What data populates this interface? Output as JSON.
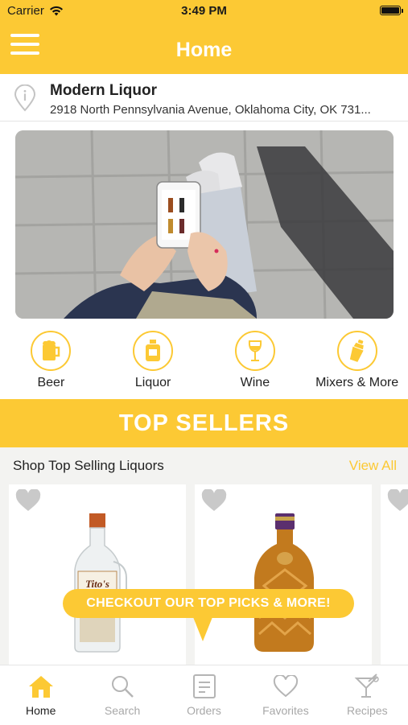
{
  "status_bar": {
    "carrier": "Carrier",
    "time": "3:49 PM"
  },
  "nav": {
    "title": "Home"
  },
  "store": {
    "name": "Modern Liquor",
    "address": "2918 North Pennsylvania Avenue, Oklahoma City, OK 731..."
  },
  "categories": [
    {
      "label": "Beer",
      "icon": "beer-mug-icon"
    },
    {
      "label": "Liquor",
      "icon": "liquor-bottle-icon"
    },
    {
      "label": "Wine",
      "icon": "wine-glass-icon"
    },
    {
      "label": "Mixers & More",
      "icon": "cocktail-shaker-icon"
    }
  ],
  "top_sellers": {
    "banner": "TOP SELLERS",
    "section_title": "Shop Top Selling Liquors",
    "view_all": "View All",
    "promo": "CHECKOUT OUR TOP PICKS & MORE!",
    "products": [
      {
        "image": "titos-vodka-bottle",
        "label_text": "Tito's"
      },
      {
        "image": "crown-royal-bottle",
        "label_text": ""
      }
    ]
  },
  "tabs": [
    {
      "label": "Home",
      "icon": "home-icon",
      "active": true
    },
    {
      "label": "Search",
      "icon": "search-icon",
      "active": false
    },
    {
      "label": "Orders",
      "icon": "orders-icon",
      "active": false
    },
    {
      "label": "Favorites",
      "icon": "heart-icon",
      "active": false
    },
    {
      "label": "Recipes",
      "icon": "cocktail-glass-icon",
      "active": false
    }
  ],
  "colors": {
    "accent": "#fcc934",
    "inactive": "#a8a8a8",
    "section_bg": "#f3f3f1"
  }
}
